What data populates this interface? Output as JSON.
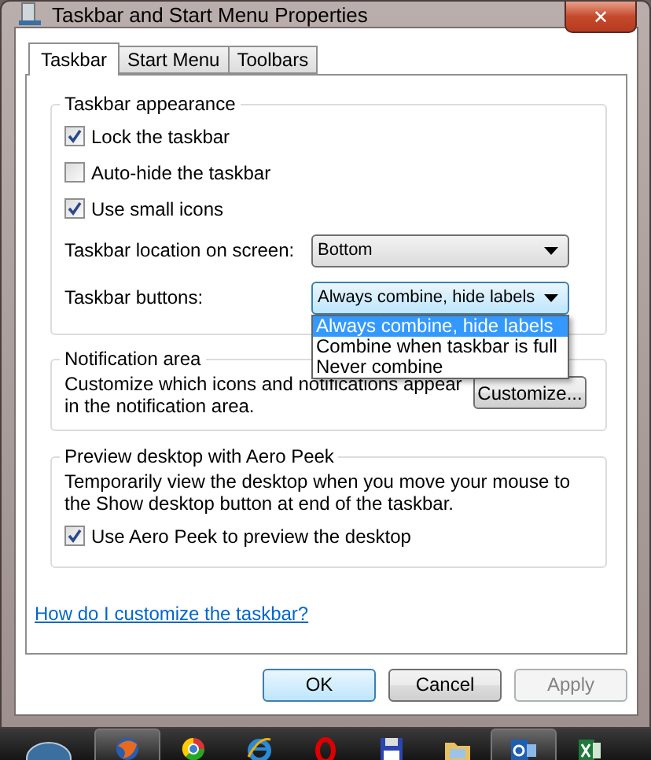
{
  "window": {
    "title": "Taskbar and Start Menu Properties",
    "close": "✕"
  },
  "tabs": [
    {
      "label": "Taskbar",
      "selected": true
    },
    {
      "label": "Start Menu",
      "selected": false
    },
    {
      "label": "Toolbars",
      "selected": false
    }
  ],
  "appearance": {
    "title": "Taskbar appearance",
    "checkboxes": [
      {
        "label": "Lock the taskbar",
        "checked": true
      },
      {
        "label": "Auto-hide the taskbar",
        "checked": false
      },
      {
        "label": "Use small icons",
        "checked": true
      }
    ],
    "location": {
      "label": "Taskbar location on screen:",
      "value": "Bottom",
      "expanded": false
    },
    "buttons": {
      "label": "Taskbar buttons:",
      "value": "Always combine, hide labels",
      "expanded": true,
      "options": [
        {
          "label": "Always combine, hide labels",
          "selected": true
        },
        {
          "label": "Combine when taskbar is full",
          "selected": false
        },
        {
          "label": "Never combine",
          "selected": false
        }
      ]
    }
  },
  "notification": {
    "title": "Notification area",
    "text": "Customize which icons and notifications appear in the notification area.",
    "button": "Customize..."
  },
  "peek": {
    "title": "Preview desktop with Aero Peek",
    "text": "Temporarily view the desktop when you move your mouse to the Show desktop button at end of the taskbar.",
    "checkbox": {
      "label": "Use Aero Peek to preview the desktop",
      "checked": true
    }
  },
  "help_link": "How do I customize the taskbar?",
  "buttons": [
    {
      "label": "OK",
      "kind": "default",
      "disabled": false
    },
    {
      "label": "Cancel",
      "kind": "normal",
      "disabled": false
    },
    {
      "label": "Apply",
      "kind": "normal",
      "disabled": true
    }
  ],
  "taskbar": [
    {
      "kind": "start",
      "active": false
    },
    {
      "kind": "fox",
      "active": true
    },
    {
      "kind": "ring",
      "active": false
    },
    {
      "kind": "e",
      "active": false
    },
    {
      "kind": "o",
      "active": false
    },
    {
      "kind": "floppy",
      "active": false
    },
    {
      "kind": "folder",
      "active": false
    },
    {
      "kind": "mail",
      "active": true
    },
    {
      "kind": "sheet",
      "active": false
    }
  ]
}
